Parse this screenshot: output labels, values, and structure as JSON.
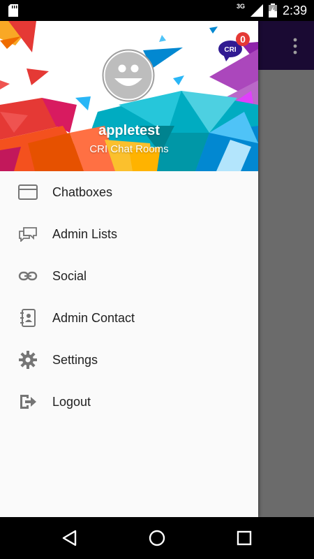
{
  "status_bar": {
    "network": "3G",
    "time": "2:39"
  },
  "header": {
    "user_name": "appletest",
    "subtitle": "CRI Chat Rooms",
    "logo_text": "CRI",
    "notification_count": "0"
  },
  "menu": {
    "items": [
      {
        "label": "Chatboxes",
        "icon": "chatbox-icon"
      },
      {
        "label": "Admin Lists",
        "icon": "chat-bubbles-icon"
      },
      {
        "label": "Social",
        "icon": "link-icon"
      },
      {
        "label": "Admin Contact",
        "icon": "contact-book-icon"
      },
      {
        "label": "Settings",
        "icon": "gear-icon"
      },
      {
        "label": "Logout",
        "icon": "logout-icon"
      }
    ]
  },
  "colors": {
    "app_toolbar": "#1a0a33",
    "badge": "#e53935",
    "menu_text": "#212121",
    "icon_gray": "#757575"
  }
}
